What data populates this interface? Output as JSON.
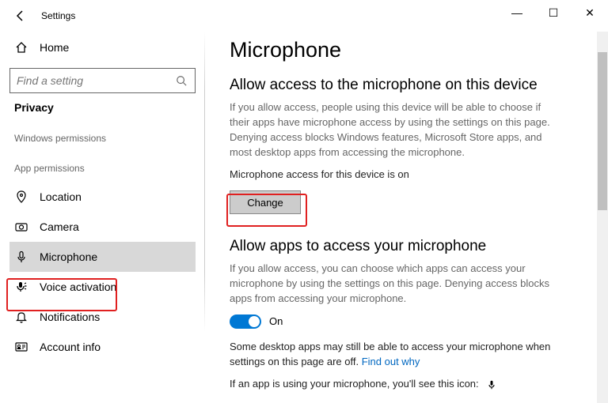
{
  "titlebar": {
    "title": "Settings"
  },
  "window_controls": {
    "minimize": "—",
    "maximize": "☐",
    "close": "✕"
  },
  "sidebar": {
    "home": "Home",
    "search_placeholder": "Find a setting",
    "privacy_label": "Privacy",
    "windows_permissions_label": "Windows permissions",
    "app_permissions_label": "App permissions",
    "items": [
      {
        "label": "Location"
      },
      {
        "label": "Camera"
      },
      {
        "label": "Microphone"
      },
      {
        "label": "Voice activation"
      },
      {
        "label": "Notifications"
      },
      {
        "label": "Account info"
      }
    ]
  },
  "main": {
    "h1": "Microphone",
    "section1": {
      "heading": "Allow access to the microphone on this device",
      "body": "If you allow access, people using this device will be able to choose if their apps have microphone access by using the settings on this page. Denying access blocks Windows features, Microsoft Store apps, and most desktop apps from accessing the microphone.",
      "status": "Microphone access for this device is on",
      "change_button": "Change"
    },
    "section2": {
      "heading": "Allow apps to access your microphone",
      "body": "If you allow access, you can choose which apps can access your microphone by using the settings on this page. Denying access blocks apps from accessing your microphone.",
      "toggle_label": "On",
      "note_prefix": "Some desktop apps may still be able to access your microphone when settings on this page are off. ",
      "note_link": "Find out why",
      "icon_note": "If an app is using your microphone, you'll see this icon:"
    }
  }
}
